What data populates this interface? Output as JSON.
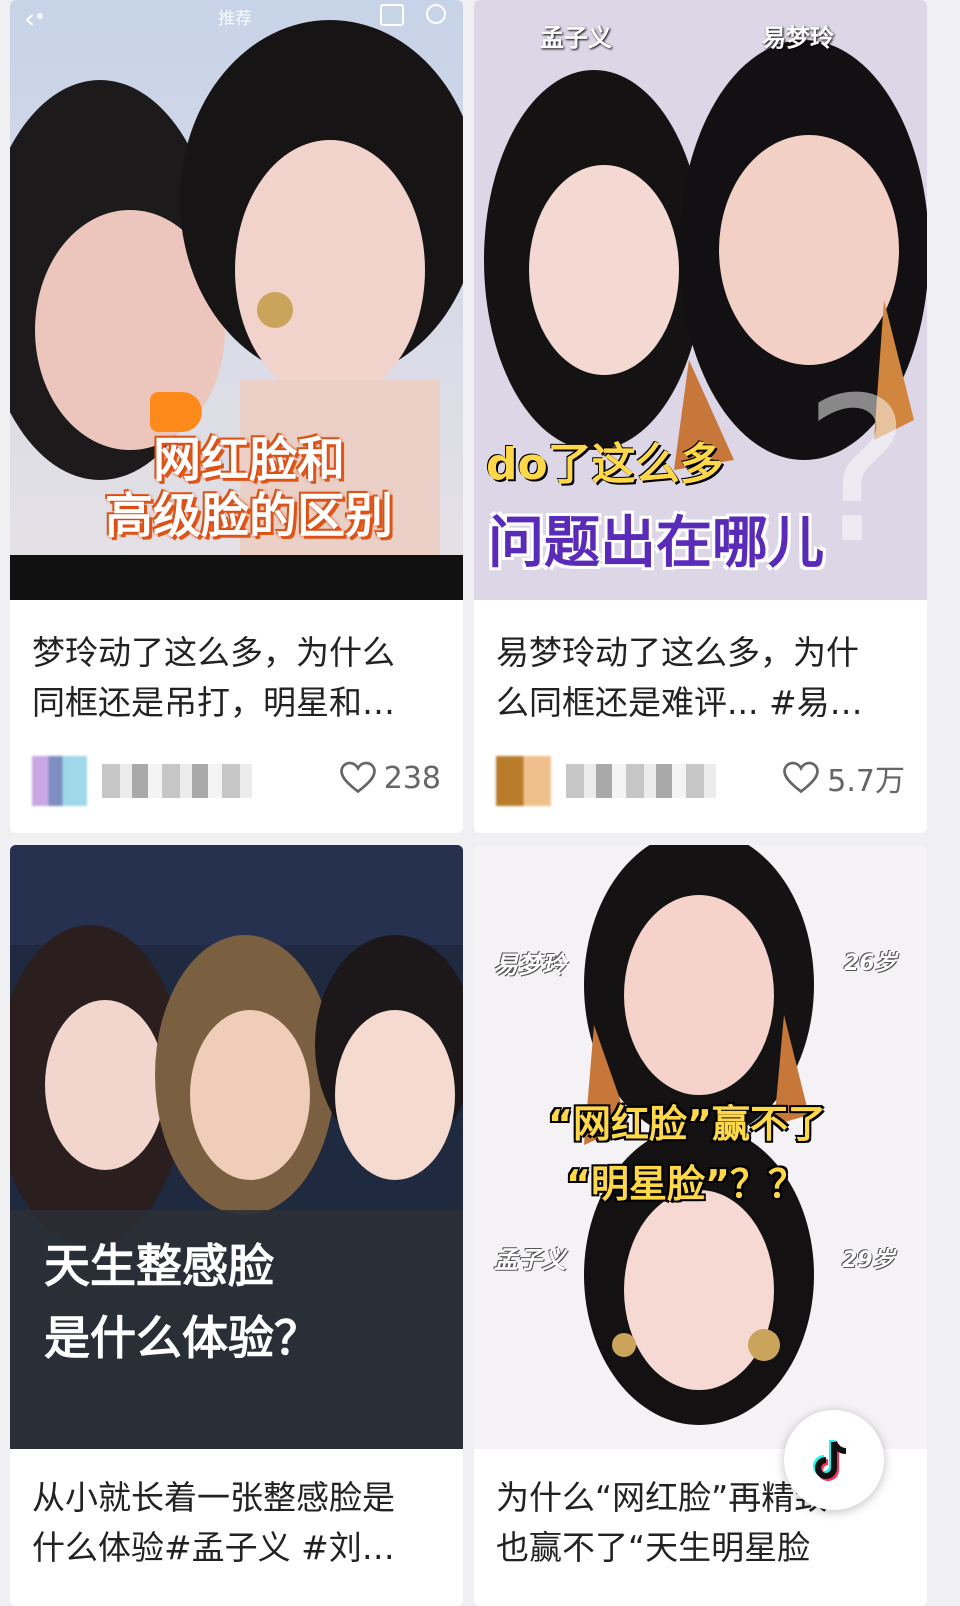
{
  "topbar": {
    "tab_label": "推荐"
  },
  "cards": [
    {
      "cover_lines": "网红脸和\n高级脸的区别",
      "title": "梦玲动了这么多，为什么\n同框还是吊打，明星和…",
      "likes": "238"
    },
    {
      "cover_names": [
        "孟子义",
        "易梦玲"
      ],
      "cover_line1": "do了这么多",
      "cover_line2": "问题出在哪儿",
      "title": "易梦玲动了这么多，为什\n么同框还是难评... #易…",
      "likes": "5.7万"
    },
    {
      "cover_lines": "天生整感脸\n是什么体验？",
      "title": "从小就长着一张整感脸是\n什么体验#孟子义 #刘…"
    },
    {
      "cover_top_name": "易梦玲",
      "cover_top_age": "26岁",
      "cover_line1": "“网红脸”赢不了",
      "cover_line2": "“明星脸”？？",
      "cover_bottom_name": "孟子义",
      "cover_bottom_age": "29岁",
      "title": "为什么“网红脸”再精致\n也赢不了“天生明星脸"
    }
  ],
  "colors": {
    "accent_yellow": "#ffd84a",
    "accent_purple": "#5a2bb8",
    "background": "#f0f0f2"
  }
}
